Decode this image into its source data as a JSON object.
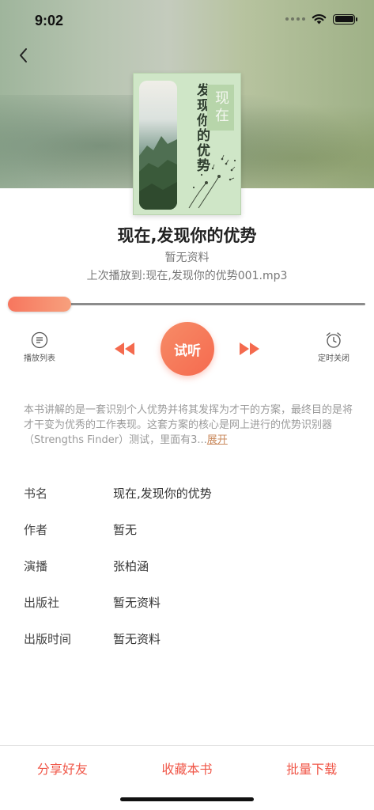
{
  "status_bar": {
    "time": "9:02",
    "icons": [
      "signal-dots-icon",
      "wifi-icon",
      "battery-icon"
    ]
  },
  "nav": {
    "back_icon": "chevron-left-icon"
  },
  "cover": {
    "vertical_title": "发现你的优势",
    "stamp_text": "现在"
  },
  "book": {
    "title": "现在,发现你的优势",
    "subtitle": "暂无资料",
    "last_played": "上次播放到:现在,发现你的优势001.mp3"
  },
  "player": {
    "progress": 0.0,
    "playlist_label": "播放列表",
    "play_label": "试听",
    "timer_label": "定时关闭",
    "accent_color": "#f56a4f"
  },
  "description": {
    "text": "本书讲解的是一套识别个人优势并将其发挥为才干的方案，最终目的是将才干变为优秀的工作表现。这套方案的核心是网上进行的优势识别器（Strengths Finder）测试，里面有3...",
    "expand_label": "展开"
  },
  "details": [
    {
      "key": "书名",
      "value": "现在,发现你的优势"
    },
    {
      "key": "作者",
      "value": "暂无"
    },
    {
      "key": "演播",
      "value": "张柏涵"
    },
    {
      "key": "出版社",
      "value": "暂无资料"
    },
    {
      "key": "出版时间",
      "value": "暂无资料"
    }
  ],
  "bottom_actions": {
    "share": "分享好友",
    "favorite": "收藏本书",
    "download": "批量下载"
  }
}
